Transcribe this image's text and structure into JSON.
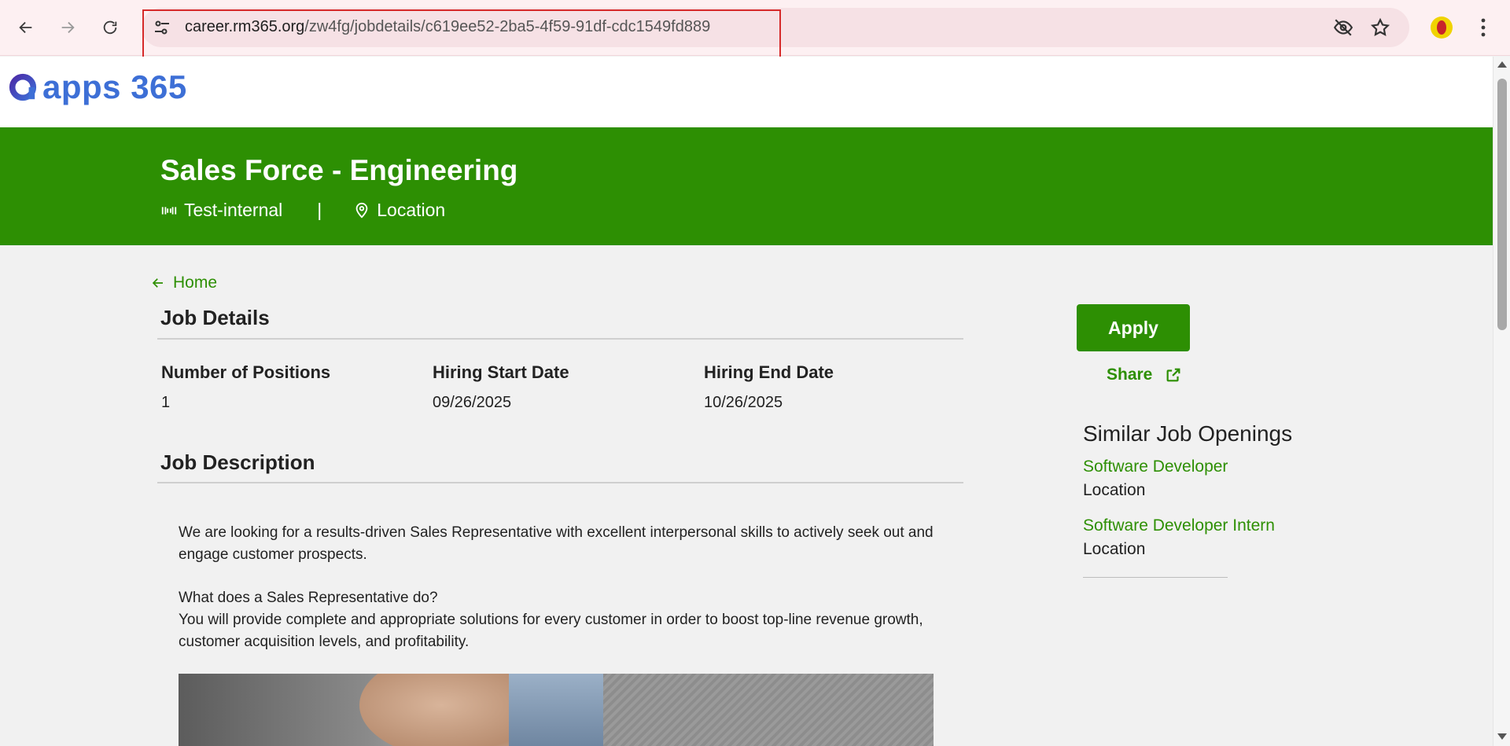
{
  "browser": {
    "url_host": "career.rm365.org",
    "url_path": "/zw4fg/jobdetails/c619ee52-2ba5-4f59-91df-cdc1549fd889"
  },
  "site": {
    "logo_text": "apps 365"
  },
  "banner": {
    "title": "Sales Force - Engineering",
    "company": "Test-internal",
    "separator": "|",
    "location": "Location"
  },
  "nav": {
    "home_label": "Home"
  },
  "job_details": {
    "heading": "Job Details",
    "fields": [
      {
        "label": "Number of Positions",
        "value": "1"
      },
      {
        "label": "Hiring Start Date",
        "value": "09/26/2025"
      },
      {
        "label": "Hiring End Date",
        "value": "10/26/2025"
      }
    ]
  },
  "job_description": {
    "heading": "Job Description",
    "intro": "We are looking for a results-driven Sales Representative with excellent interpersonal skills to actively seek out and engage customer prospects.",
    "subheading": "What does a Sales Representative do?",
    "body": "You will provide complete and appropriate solutions for every customer in order to boost top-line revenue growth, customer acquisition levels, and profitability."
  },
  "actions": {
    "apply_label": "Apply",
    "share_label": "Share"
  },
  "similar": {
    "heading": "Similar Job Openings",
    "jobs": [
      {
        "title": "Software Developer",
        "location": "Location"
      },
      {
        "title": "Software Developer Intern",
        "location": "Location"
      }
    ]
  },
  "colors": {
    "brand_green": "#2d8f03",
    "logo_blue": "#3d6fd6",
    "highlight_red": "#d62a2a"
  }
}
